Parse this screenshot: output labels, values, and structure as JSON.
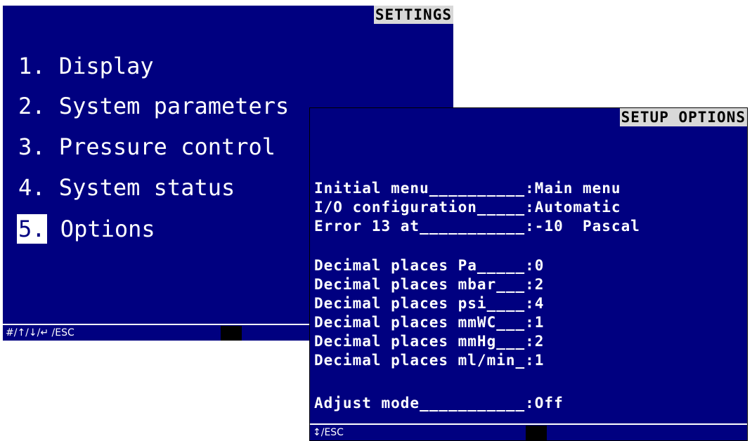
{
  "settings": {
    "title": "SETTINGS",
    "items": [
      {
        "num": "1.",
        "label": "Display"
      },
      {
        "num": "2.",
        "label": "System parameters"
      },
      {
        "num": "3.",
        "label": "Pressure control"
      },
      {
        "num": "4.",
        "label": "System status"
      },
      {
        "num": "5.",
        "label": "Options"
      }
    ],
    "selected_index": 4,
    "status_keys": "#/↑/↓/↵ /ESC"
  },
  "setup": {
    "title": "SETUP OPTIONS",
    "options": [
      {
        "text": "Initial menu__________:Main menu"
      },
      {
        "text": "I/O configuration_____:Automatic"
      },
      {
        "text": "Error 13 at___________:-10  Pascal"
      },
      {
        "text": "Decimal places Pa_____:0"
      },
      {
        "text": "Decimal places mbar___:2"
      },
      {
        "text": "Decimal places psi____:4"
      },
      {
        "text": "Decimal places mmWC___:1"
      },
      {
        "text": "Decimal places mmHg___:2"
      },
      {
        "text": "Decimal places ml/min_:1"
      },
      {
        "text": "Adjust mode___________:Off"
      }
    ],
    "status_keys": "↕/ESC"
  },
  "colors": {
    "screen_bg": "#000080",
    "screen_fg": "#ffffff",
    "title_bg": "#d8d8d8"
  }
}
